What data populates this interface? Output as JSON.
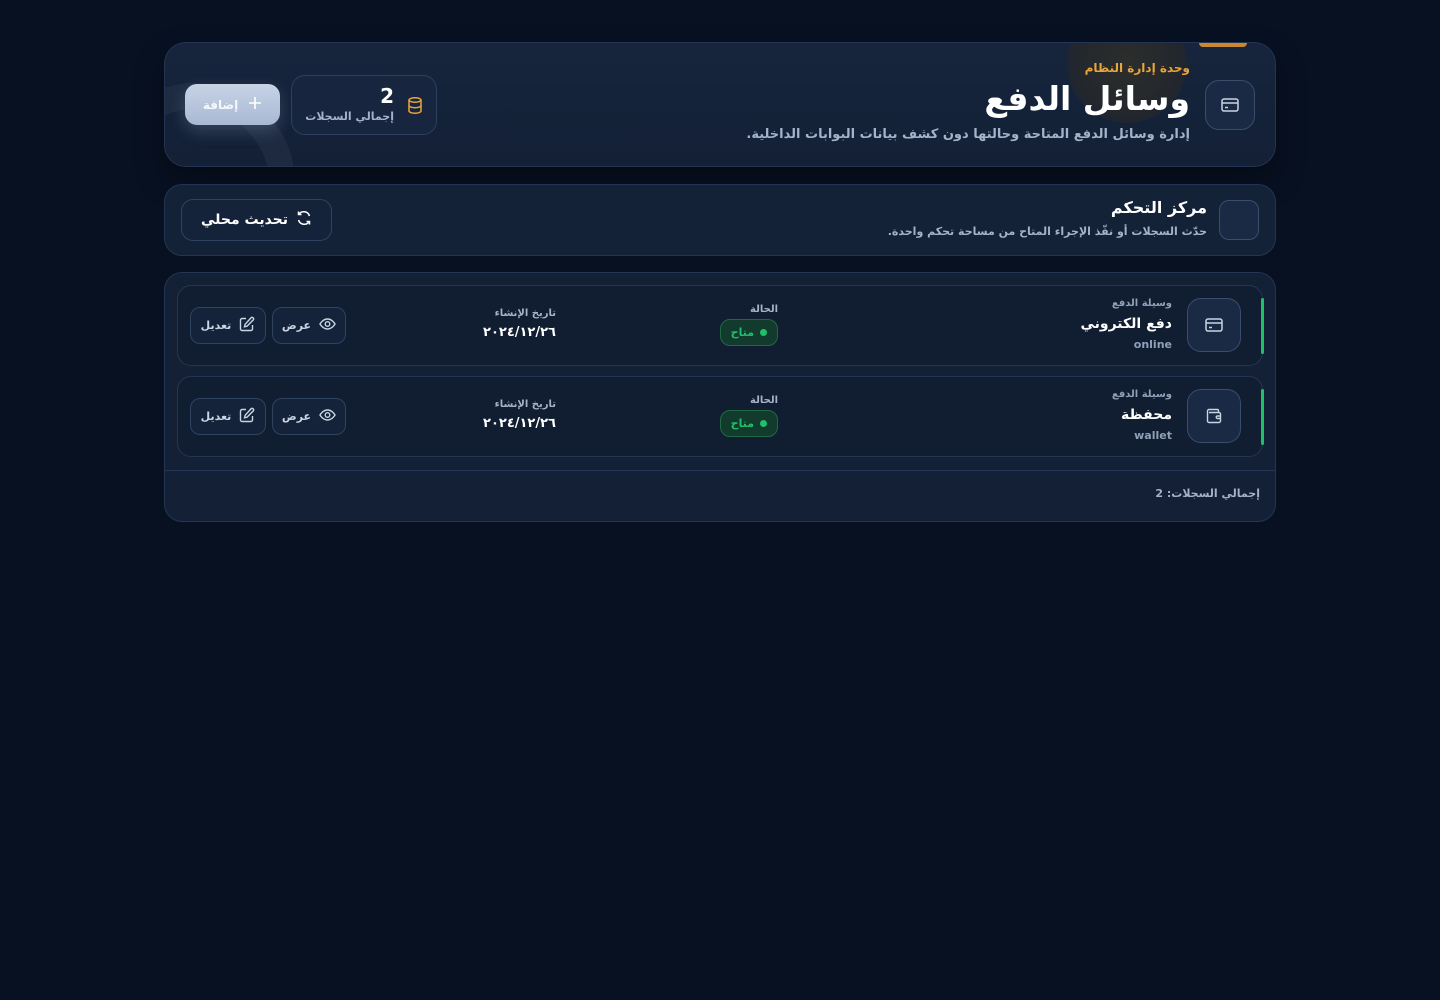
{
  "header": {
    "eyebrow": "وحدة إدارة النظام",
    "title": "وسائل الدفع",
    "subtitle": "إدارة وسائل الدفع المتاحة وحالتها دون كشف بيانات البوابات الداخلية.",
    "stat_value": "2",
    "stat_label": "إجمالي السجلات",
    "add_label": "إضافة",
    "accent_color": "#e8a53a"
  },
  "control": {
    "title": "مركز التحكم",
    "subtitle": "حدّث السجلات أو نفّذ الإجراء المتاح من مساحة تحكم واحدة.",
    "refresh_label": "تحديث محلي"
  },
  "rows": [
    {
      "type_label": "وسيلة الدفع",
      "name": "دفع الكتروني",
      "code": "online",
      "status_label": "الحالة",
      "status": "متاح",
      "date_label": "تاريخ الإنشاء",
      "date": "٢٠٢٤/١٢/٢٦",
      "view_label": "عرض",
      "edit_label": "تعديل",
      "icon": "card-icon"
    },
    {
      "type_label": "وسيلة الدفع",
      "name": "محفظة",
      "code": "wallet",
      "status_label": "الحالة",
      "status": "متاح",
      "date_label": "تاريخ الإنشاء",
      "date": "٢٠٢٤/١٢/٢٦",
      "view_label": "عرض",
      "edit_label": "تعديل",
      "icon": "wallet-icon"
    }
  ],
  "footer": {
    "total": "إجمالي السجلات: 2"
  },
  "colors": {
    "background": "#081122",
    "status_green": "#1fc06b"
  }
}
